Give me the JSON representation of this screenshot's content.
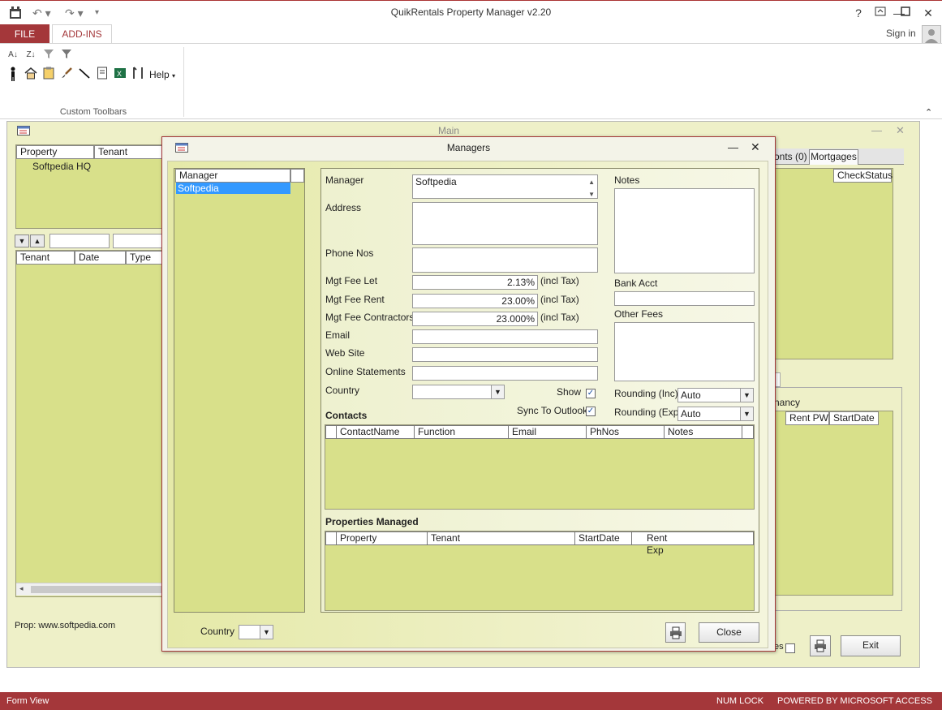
{
  "app": {
    "title": "QuikRentals Property Manager  v2.20",
    "help": "?",
    "sign_in": "Sign in"
  },
  "ribbon": {
    "tabs": [
      {
        "label": "FILE"
      },
      {
        "label": "ADD-INS"
      }
    ],
    "help_menu": "Help",
    "group_label": "Custom Toolbars",
    "icons": [
      "sort-ascending-icon",
      "sort-descending-icon",
      "clear-filter-icon",
      "filter-icon",
      "person-icon",
      "house-icon",
      "clipboard-icon",
      "paintbrush-icon",
      "pen-icon",
      "document-icon",
      "excel-icon",
      "tools-icon"
    ]
  },
  "main_form": {
    "title": "Main",
    "property_list": {
      "headers": [
        "Property",
        "Tenant"
      ],
      "rows": [
        {
          "property": "Softpedia HQ"
        }
      ]
    },
    "tenant_list": {
      "headers": [
        "Tenant",
        "Date",
        "Type"
      ]
    },
    "right_tabs": [
      "onts (0)",
      "Mortgages"
    ],
    "right_grid_header": "CheckStatus",
    "tenancy_label": "nancy",
    "tenancy_headers": [
      "Rent PW",
      "StartDate"
    ],
    "prop_footer": "Prop: www.softpedia.com",
    "checkbox_label_fragment": "es",
    "exit_label": "Exit"
  },
  "managers_dialog": {
    "title": "Managers",
    "list_header": "Manager",
    "list_items": [
      {
        "name": "Softpedia",
        "selected": true
      }
    ],
    "fields": {
      "manager_label": "Manager",
      "manager_value": "Softpedia",
      "address_label": "Address",
      "address_value": "",
      "phone_label": "Phone Nos",
      "phone_value": "",
      "mgt_fee_let_label": "Mgt Fee Let",
      "mgt_fee_let_value": "2.13%",
      "mgt_fee_rent_label": "Mgt Fee Rent",
      "mgt_fee_rent_value": "23.00%",
      "mgt_fee_contractors_label": "Mgt Fee Contractors",
      "mgt_fee_contractors_value": "23.000%",
      "incl_tax": "(incl Tax)",
      "email_label": "Email",
      "website_label": "Web Site",
      "online_statements_label": "Online Statements",
      "country_label": "Country",
      "show_label": "Show",
      "show_checked": true,
      "sync_outlook_label": "Sync To Outlook",
      "sync_outlook_checked": true,
      "notes_label": "Notes",
      "bank_acct_label": "Bank Acct",
      "other_fees_label": "Other Fees",
      "rounding_inc_label": "Rounding (Inc)",
      "rounding_inc_value": "Auto",
      "rounding_exp_label": "Rounding (Exp)",
      "rounding_exp_value": "Auto"
    },
    "contacts": {
      "title": "Contacts",
      "headers": [
        "ContactName",
        "Function",
        "Email",
        "PhNos",
        "Notes"
      ]
    },
    "properties_managed": {
      "title": "Properties Managed",
      "headers": [
        "Property",
        "Tenant",
        "StartDate",
        "Rent Exp"
      ]
    },
    "footer_country_label": "Country",
    "close_label": "Close"
  },
  "statusbar": {
    "left": "Form View",
    "num_lock": "NUM LOCK",
    "powered_by": "POWERED BY MICROSOFT ACCESS"
  },
  "colors": {
    "accent": "#a4373a",
    "panel": "#d8e08a",
    "selection": "#3399ff"
  }
}
